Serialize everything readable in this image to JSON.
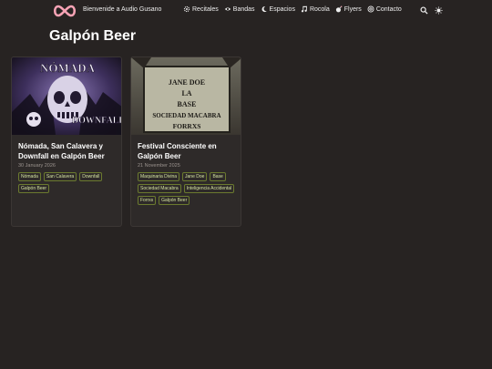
{
  "header": {
    "brand": "Bienvenide a Audio Gusano",
    "menu": [
      {
        "label": "Recitales",
        "icon": "gear-icon"
      },
      {
        "label": "Bandas",
        "icon": "eye-icon"
      },
      {
        "label": "Espacios",
        "icon": "moon-icon"
      },
      {
        "label": "Rocola",
        "icon": "music-note-icon"
      },
      {
        "label": "Flyers",
        "icon": "bomb-icon"
      },
      {
        "label": "Contacto",
        "icon": "at-icon"
      }
    ],
    "accent_color": "#f7a3b5"
  },
  "page": {
    "title": "Galpón Beer"
  },
  "cards": [
    {
      "image_text": [
        "NÓMADA",
        "DOWNFALL"
      ],
      "title": "Nómada, San Calavera y Downfall en Galpón Beer",
      "date": "30 January 2026",
      "tags": [
        "Nómada",
        "San Calavera",
        "Downfall",
        "Galpón Beer"
      ]
    },
    {
      "image_text": [
        "JANE DOE",
        "LA",
        "BASE",
        "SOCIEDAD MACABRA",
        "FORRXS"
      ],
      "title": "Festival Consciente en Galpón Beer",
      "date": "21 November 2025",
      "tags": [
        "Maquinaria Divina",
        "Jane Doe",
        "Base",
        "Sociedad Macabra",
        "Inteligencia Accidental",
        "Forrxs",
        "Galpón Beer"
      ]
    }
  ]
}
